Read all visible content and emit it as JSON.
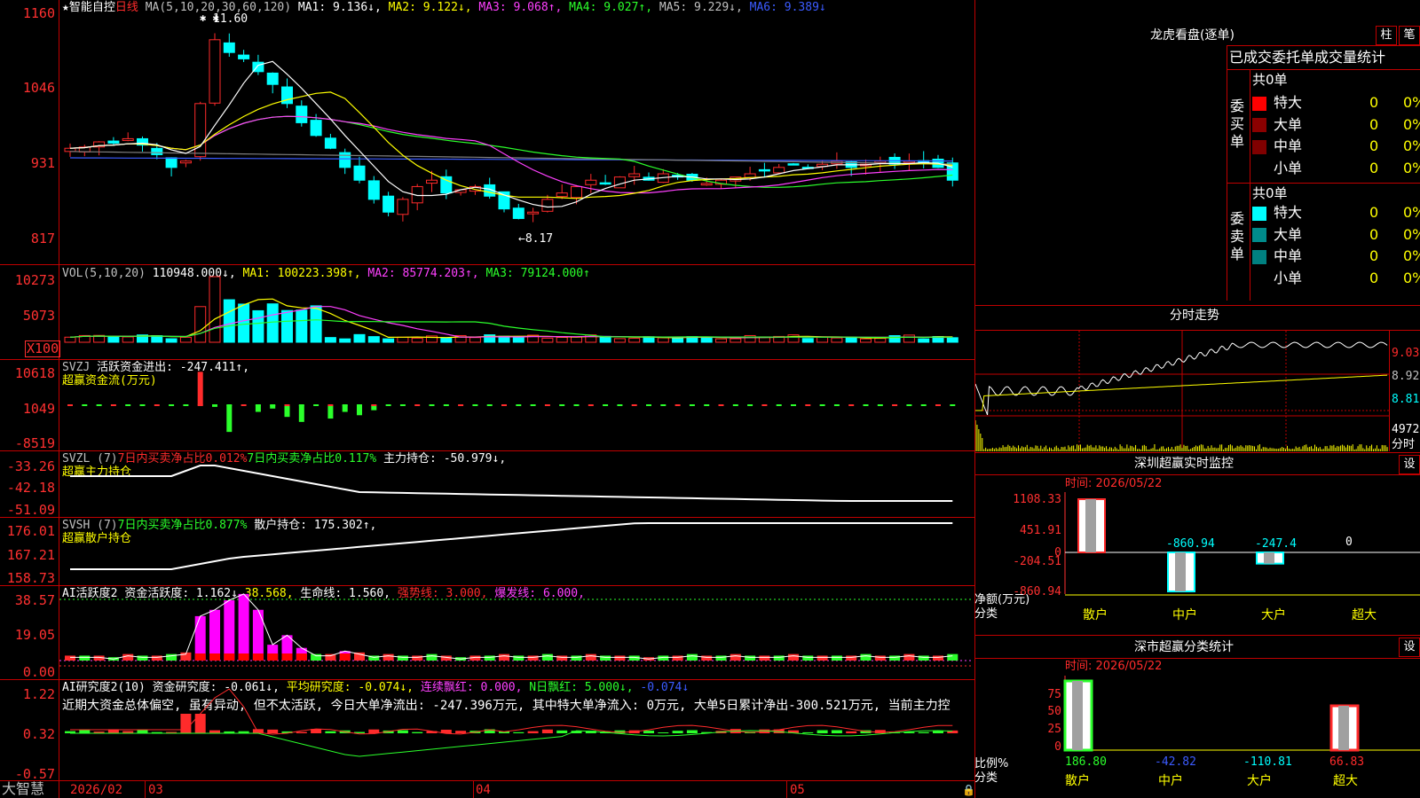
{
  "title_bar": {
    "star": "★",
    "stock_name": "智能自控",
    "period": "日线",
    "ma_params": "MA(5,10,20,30,60,120)",
    "ma1_label": "MA1: 9.136↓,",
    "ma2_label": "MA2: 9.122↓,",
    "ma3_label": "MA3: 9.068↑,",
    "ma4_label": "MA4: 9.027↑,",
    "ma5_label": "MA5: 9.229↓,",
    "ma6_label": "MA6: 9.389↓"
  },
  "price_axis": [
    "1160",
    "1046",
    "931",
    "817"
  ],
  "price_annotations": {
    "high": "11.60",
    "low": "←8.17"
  },
  "vol_bar": {
    "params": "VOL(5,10,20)",
    "value": "110948.000↓,",
    "ma1": "MA1: 100223.398↑,",
    "ma2": "MA2: 85774.203↑,",
    "ma3": "MA3: 79124.000↑"
  },
  "vol_axis": [
    "10273",
    "5073",
    "X100"
  ],
  "svzj": {
    "params": "SVZJ",
    "line1": "活跃资金进出: -247.411↑,",
    "line2": "超赢资金流(万元)",
    "axis": [
      "10618",
      "1049",
      "-8519"
    ]
  },
  "svzl": {
    "params": "SVZL (7)",
    "p1": "7日内买卖净占比0.012%",
    "p2": "7日内买卖净占比0.117%",
    "p3": "主力持仓: -50.979↓,",
    "line2": "超赢主力持仓",
    "axis": [
      "-33.26",
      "-42.18",
      "-51.09"
    ]
  },
  "svsh": {
    "params": "SVSH (7)",
    "p1": "7日内买卖净占比0.877%",
    "p2": "散户持仓: 175.302↑,",
    "line2": "超赢散户持仓",
    "axis": [
      "176.01",
      "167.21",
      "158.73"
    ]
  },
  "ai_active": {
    "params": "AI活跃度2",
    "p1": "资金活跃度: 1.162↓,",
    "p2": "38.568,",
    "p3": "生命线: 1.560,",
    "p4": "强势线: 3.000,",
    "p5": "爆发线: 6.000,",
    "axis": [
      "38.57",
      "19.05",
      "0.00"
    ]
  },
  "ai_research": {
    "params": "AI研究度2(10)",
    "p1": "资金研究度: -0.061↓,",
    "p2": "平均研究度: -0.074↓,",
    "p3": "连续飘红: 0.000,",
    "p4": "N日飘红: 5.000↓,",
    "p5": "-0.074↓",
    "comment": "近期大资金总体偏空, 虽有异动, 但不太活跃, 今日大单净流出: -247.396万元, 其中特大单净流入: 0万元, 大单5日累计净出-300.521万元, 当前主力控",
    "axis": [
      "1.22",
      "0.32",
      "-0.57"
    ]
  },
  "date_axis": {
    "brand": "大智慧",
    "d1": "2026/02",
    "d2": "03",
    "d3": "04",
    "d4": "05"
  },
  "dragon": {
    "title": "龙虎看盘(逐单)",
    "btn1": "柱",
    "btn2": "笔",
    "tabs": "已成交委托单成交量统计",
    "buy_label": "委买单",
    "sell_label": "委卖单",
    "buy_total": "共0单",
    "sell_total": "共0单",
    "buy_rows": [
      {
        "name": "特大",
        "count": "0",
        "pct": "0%",
        "color": "#ff0000"
      },
      {
        "name": "大单",
        "count": "0",
        "pct": "0%",
        "color": "#8b0000"
      },
      {
        "name": "中单",
        "count": "0",
        "pct": "0%",
        "color": "#800000"
      },
      {
        "name": "小单",
        "count": "0",
        "pct": "0%",
        "color": ""
      }
    ],
    "sell_rows": [
      {
        "name": "特大",
        "count": "0",
        "pct": "0%",
        "color": "#00ffff"
      },
      {
        "name": "大单",
        "count": "0",
        "pct": "0%",
        "color": "#008b8b"
      },
      {
        "name": "中单",
        "count": "0",
        "pct": "0%",
        "color": "#008080"
      },
      {
        "name": "小单",
        "count": "0",
        "pct": "0%",
        "color": ""
      }
    ]
  },
  "intraday": {
    "title": "分时走势",
    "axis": [
      "9.03",
      "8.92",
      "8.81"
    ],
    "vol_max": "4972",
    "vol_label": "分时"
  },
  "sz_monitor": {
    "title": "深圳超赢实时监控",
    "settings": "设",
    "time": "时间: 2026/05/22",
    "axis": [
      "1108.33",
      "451.91",
      "0",
      "-204.51",
      "-860.94"
    ],
    "ylabel": "净额(万元)",
    "xlabel": "分类",
    "bars": [
      {
        "cat": "散户",
        "value": "1108.33"
      },
      {
        "cat": "中户",
        "value": "-860.94"
      },
      {
        "cat": "大户",
        "value": "-247.4"
      },
      {
        "cat": "超大",
        "value": "0"
      }
    ]
  },
  "sz_class": {
    "title": "深市超赢分类统计",
    "settings": "设",
    "time": "时间: 2026/05/22",
    "axis": [
      "75",
      "50",
      "25",
      "0"
    ],
    "ylabel": "比例%",
    "xlabel": "分类",
    "bars": [
      {
        "cat": "散户",
        "value": "186.80"
      },
      {
        "cat": "中户",
        "value": "-42.82"
      },
      {
        "cat": "大户",
        "value": "-110.81"
      },
      {
        "cat": "超大",
        "value": "66.83"
      }
    ]
  },
  "colors": {
    "up": "#ff2b2b",
    "down": "#00ffff",
    "grid": "#c00000",
    "ma1": "#ffffff",
    "ma2": "#ffff00",
    "ma3": "#ff40ff",
    "ma4": "#2bff2b",
    "ma5": "#808080",
    "ma6": "#3b5bff"
  }
}
